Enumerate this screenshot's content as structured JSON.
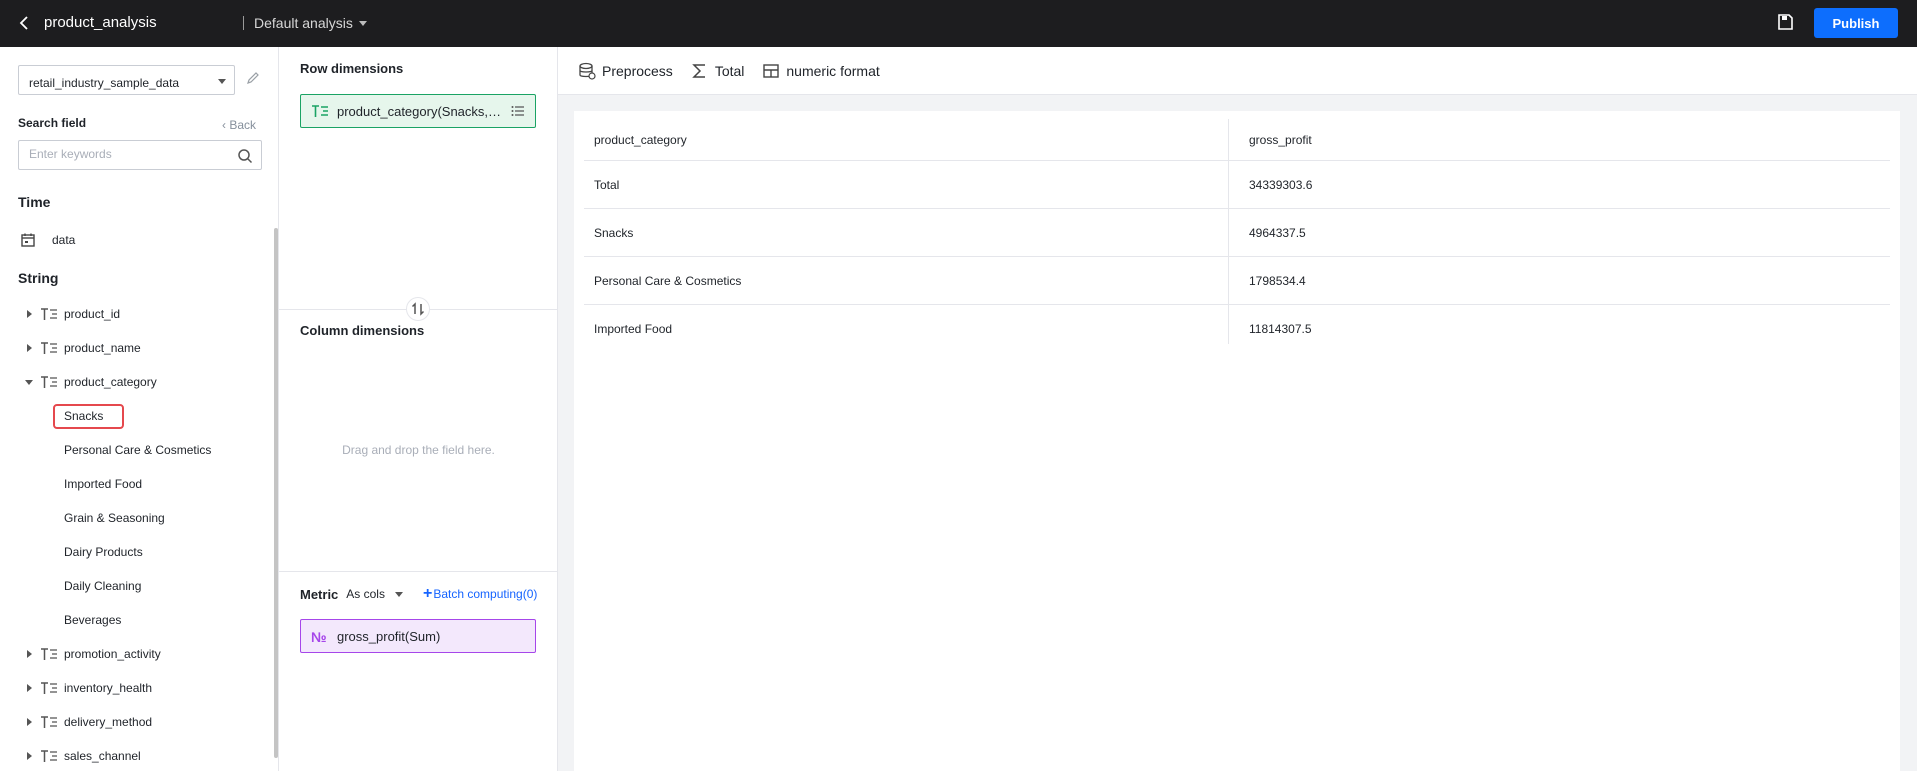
{
  "header": {
    "title": "product_analysis",
    "analysis_name": "Default analysis",
    "publish_label": "Publish"
  },
  "left_panel": {
    "dataset": "retail_industry_sample_data",
    "search_label": "Search field",
    "back_label": "Back",
    "search_placeholder": "Enter keywords",
    "groups": {
      "time": "Time",
      "string": "String"
    },
    "time_field": "data",
    "string_fields": [
      "product_id",
      "product_name",
      "product_category",
      "promotion_activity",
      "inventory_health",
      "delivery_method",
      "sales_channel"
    ],
    "category_values": [
      "Snacks",
      "Personal Care & Cosmetics",
      "Imported Food",
      "Grain & Seasoning",
      "Dairy Products",
      "Daily Cleaning",
      "Beverages"
    ]
  },
  "middle_panel": {
    "row_dimensions_label": "Row dimensions",
    "row_chip": "product_category(Snacks,Personal Care & Cosmetics,Imported Food)",
    "column_dimensions_label": "Column dimensions",
    "drop_hint": "Drag and drop the field here.",
    "metric_label": "Metric",
    "metric_mode": "As cols",
    "batch_label": "Batch computing(0)",
    "metric_chip": "gross_profit(Sum)"
  },
  "toolbar": {
    "preprocess": "Preprocess",
    "total": "Total",
    "numeric_format": "numeric format"
  },
  "table": {
    "columns": [
      "product_category",
      "gross_profit"
    ],
    "rows": [
      [
        "Total",
        "34339303.6"
      ],
      [
        "Snacks",
        "4964337.5"
      ],
      [
        "Personal Care & Cosmetics",
        "1798534.4"
      ],
      [
        "Imported Food",
        "11814307.5"
      ]
    ]
  }
}
